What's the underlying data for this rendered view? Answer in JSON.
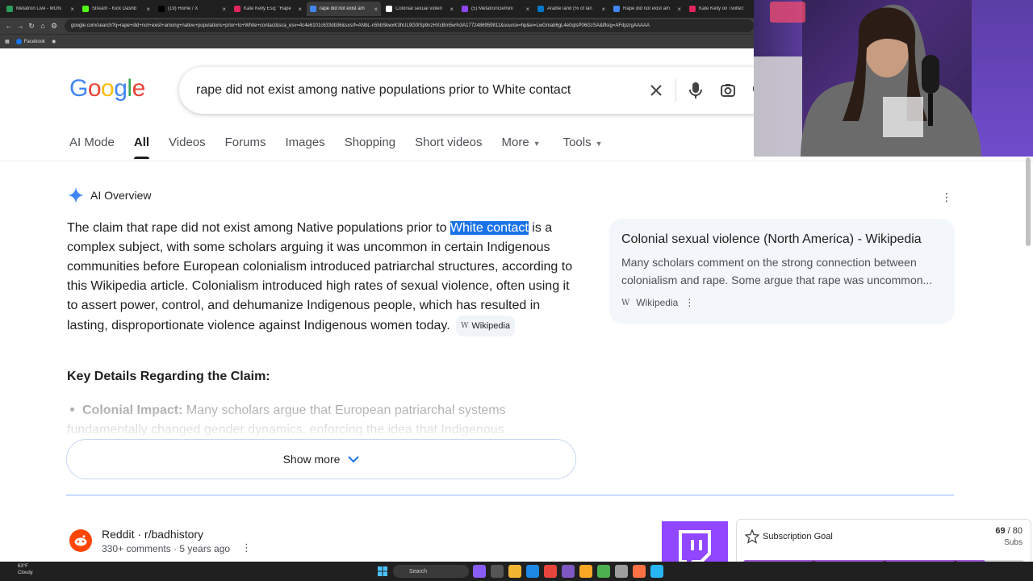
{
  "browser": {
    "tabs": [
      {
        "title": "Metatron Live - MON",
        "color": "#2a9d5c",
        "active": false
      },
      {
        "title": "Stream - Kick Dashb",
        "color": "#53fc18",
        "active": false
      },
      {
        "title": "(19) Home / X",
        "color": "#000000",
        "active": false
      },
      {
        "title": "Kate Kelly Esq: \"Rape",
        "color": "#e0245e",
        "active": false
      },
      {
        "title": "rape did not exist am",
        "color": "#4285f4",
        "active": true
      },
      {
        "title": "Colonial sexual violen",
        "color": "#ffffff",
        "active": false
      },
      {
        "title": "(5) MetatronGemini",
        "color": "#8e44ff",
        "active": false
      },
      {
        "title": "Arable land (% of lan",
        "color": "#0077c8",
        "active": false
      },
      {
        "title": "Rape did not exist am",
        "color": "#4285f4",
        "active": false
      },
      {
        "title": "Kate Kelly on Twitter:",
        "color": "#e0245e",
        "active": false
      }
    ],
    "url": "google.com/search?q=rape+did+not+exist+among+native+populations+prior+to+White+contact&sca_esv=4c4e6101c633db36&sxsrf=ANbL-n5hbSkwxK3hUL9G0lSp9nzHXcBm5w%3A1772486959811&source=hp&ei=LwGmab6gL4e0qtsP06GzSA&iflsig=AFdpzrgAAAAA",
    "bookmark_label": "Facebook"
  },
  "search": {
    "logo": "Google",
    "query": "rape did not exist among native populations prior to White contact"
  },
  "nav_tabs": {
    "ai_mode": "AI Mode",
    "all": "All",
    "videos": "Videos",
    "forums": "Forums",
    "images": "Images",
    "shopping": "Shopping",
    "short_videos": "Short videos",
    "more": "More",
    "tools": "Tools"
  },
  "ai_overview": {
    "heading": "AI Overview",
    "para_before": "The claim that rape did not exist among Native populations prior to ",
    "para_highlight": "White contact",
    "para_after": " is a complex subject, with some scholars arguing it was uncommon in certain Indigenous communities before European colonialism introduced patriarchal structures, according to this Wikipedia article. Colonialism introduced high rates of sexual violence, often using it to assert power, control, and dehumanize Indigenous people, which has resulted in lasting, disproportionate violence against Indigenous women today.",
    "chip_label": "Wikipedia",
    "key_heading": "Key Details Regarding the Claim:",
    "bullet_label": "Colonial Impact:",
    "bullet_text": " Many scholars argue that European patriarchal systems fundamentally changed gender dynamics, enforcing the idea that Indigenous",
    "show_more": "Show more"
  },
  "source_card": {
    "title": "Colonial sexual violence (North America) - Wikipedia",
    "snippet": "Many scholars comment on the strong connection between colonialism and rape. Some argue that rape was uncommon...",
    "site": "Wikipedia"
  },
  "result": {
    "name": "Reddit · r/badhistory",
    "meta": "330+ comments · 5 years ago"
  },
  "sub_goal": {
    "title": "Subscription Goal",
    "current": "69",
    "target": "/ 80",
    "unit": "Subs",
    "progress_fraction": 0.8625
  },
  "taskbar": {
    "temp": "63°F",
    "condition": "Cloudy",
    "search_label": "Search"
  },
  "colors": {
    "google_blue": "#4285f4",
    "google_red": "#ea4335",
    "google_yellow": "#fbbc05",
    "google_green": "#34a853",
    "highlight": "#1a73e8",
    "twitch_purple": "#9146ff"
  }
}
